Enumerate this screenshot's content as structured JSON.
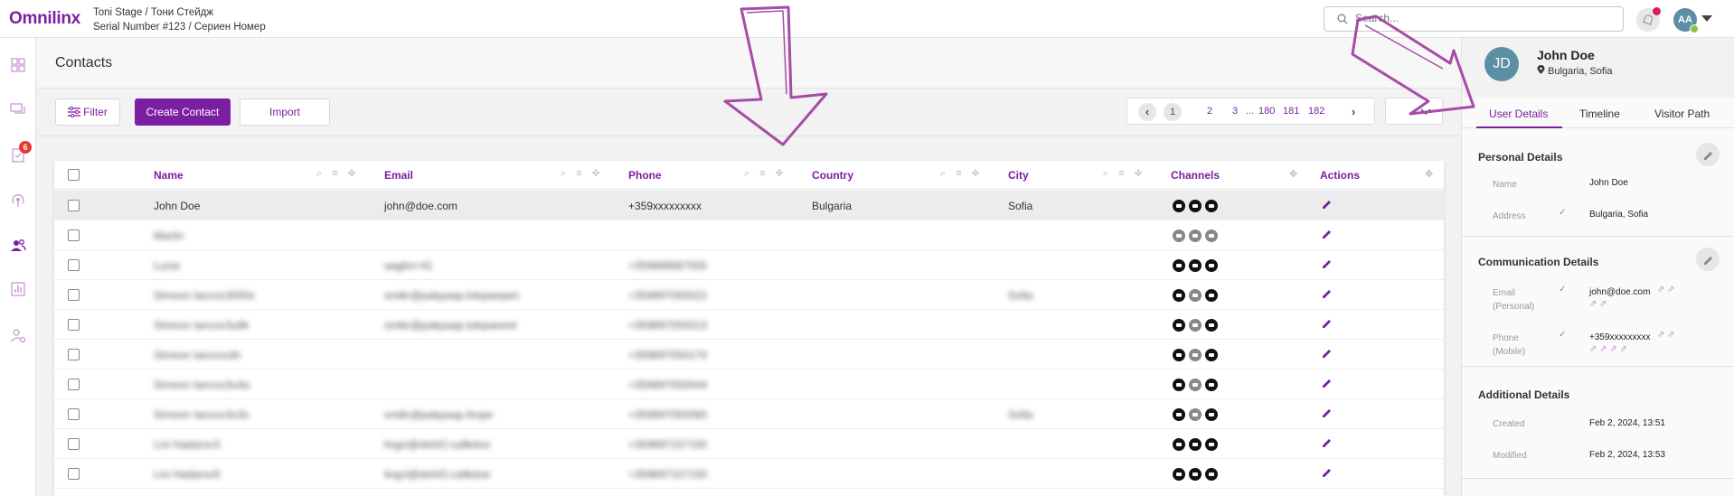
{
  "app": {
    "logo": "Omnilinx",
    "stage_line": "Toni Stage / Тони Стейдж",
    "serial_line": "Serial Number #123 / Сериен Номер",
    "search_placeholder": "Search...",
    "user_initials": "AA"
  },
  "sidebar": {
    "items": [
      {
        "icon": "dashboard-icon"
      },
      {
        "icon": "chat-icon"
      },
      {
        "icon": "tasks-icon",
        "badge": "6"
      },
      {
        "icon": "broadcast-icon"
      },
      {
        "icon": "contacts-icon",
        "active": true
      },
      {
        "icon": "reports-icon"
      },
      {
        "icon": "user-settings-icon"
      }
    ]
  },
  "page": {
    "title": "Contacts"
  },
  "toolbar": {
    "filter_label": "Filter",
    "create_label": "Create Contact",
    "import_label": "Import"
  },
  "pagination": {
    "pages": [
      "1",
      "2",
      "3",
      "...",
      "180",
      "181",
      "182"
    ],
    "current": "1"
  },
  "table": {
    "columns": [
      "Name",
      "Email",
      "Phone",
      "Country",
      "City",
      "Channels",
      "Actions"
    ],
    "rows": [
      {
        "name": "John Doe",
        "email": "john@doe.com",
        "phone": "+359xxxxxxxxx",
        "country": "Bulgaria",
        "city": "Sofia",
        "channels": [
          "black",
          "black",
          "black"
        ],
        "selected": true
      },
      {
        "name": "Martin",
        "email": "",
        "phone": "",
        "country": "",
        "city": "",
        "channels": [
          "grey",
          "grey",
          "grey"
        ]
      },
      {
        "name": "Lucia",
        "email": "aagbo+41",
        "phone": "+359888887555",
        "country": "",
        "city": "",
        "channels": [
          "black",
          "black",
          "black"
        ]
      },
      {
        "name": "Simeon Iancov3000z",
        "email": "smtkr@pakpaap.lolepaepen",
        "phone": "+359897050022",
        "country": "",
        "city": "Sofia",
        "channels": [
          "black",
          "grey",
          "black"
        ]
      },
      {
        "name": "Simeon Iancov3u6k",
        "email": "smtkr@pakpaap.lolepaeent",
        "phone": "+359897050013",
        "country": "",
        "city": "",
        "channels": [
          "black",
          "grey",
          "black"
        ]
      },
      {
        "name": "Simeon Iancovuth",
        "email": "",
        "phone": "+359897050170",
        "country": "",
        "city": "",
        "channels": [
          "black",
          "grey",
          "black"
        ]
      },
      {
        "name": "Simeon Iancov3u4a",
        "email": "",
        "phone": "+359897050044",
        "country": "",
        "city": "",
        "channels": [
          "black",
          "grey",
          "black"
        ]
      },
      {
        "name": "Simeon Iancov3u3s",
        "email": "smtkr@pakpaap.ihope",
        "phone": "+359897050060",
        "country": "",
        "city": "Sofia",
        "channels": [
          "black",
          "grey",
          "black"
        ]
      },
      {
        "name": "Livi Hadarov3",
        "email": "livgcl@dshiO.callkdon",
        "phone": "+359897157150",
        "country": "",
        "city": "",
        "channels": [
          "black",
          "black",
          "black"
        ]
      },
      {
        "name": "Livi Hadarov5",
        "email": "livgcl@dshiO.callkdoe",
        "phone": "+359897157150",
        "country": "",
        "city": "",
        "channels": [
          "black",
          "black",
          "black"
        ]
      }
    ]
  },
  "contact_panel": {
    "initials": "JD",
    "name": "John Doe",
    "location": "Bulgaria, Sofia",
    "tabs": [
      "User Details",
      "Timeline",
      "Visitor Path"
    ],
    "active_tab": "User Details",
    "personal": {
      "title": "Personal Details",
      "name_label": "Name",
      "name_value": "John Doe",
      "address_label": "Address",
      "address_value": "Bulgaria, Sofia"
    },
    "communication": {
      "title": "Communication Details",
      "email_label": "Email",
      "email_sub": "(Personal)",
      "email_value": "john@doe.com",
      "phone_label": "Phone",
      "phone_sub": "(Mobile)",
      "phone_value": "+359xxxxxxxxx"
    },
    "additional": {
      "title": "Additional Details",
      "created_label": "Created",
      "created_value": "Feb 2, 2024, 13:51",
      "modified_label": "Modified",
      "modified_value": "Feb 2, 2024, 13:53"
    }
  },
  "colors": {
    "accent": "#7b1fa2",
    "annotation": "#a64ca6"
  }
}
